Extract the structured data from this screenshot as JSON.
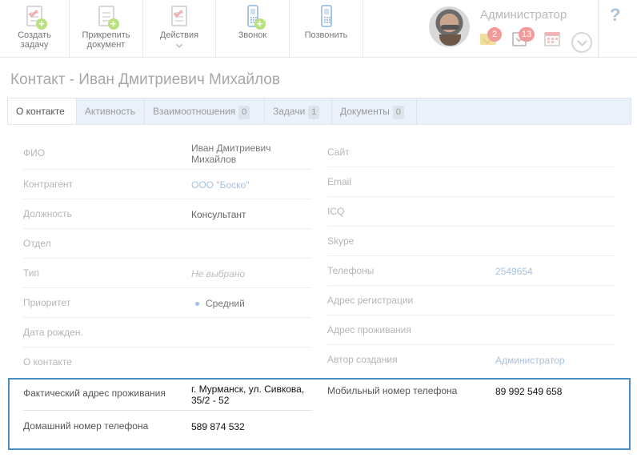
{
  "toolbar": {
    "create_task": "Создать\nзадачу",
    "attach_doc": "Прикрепить\nдокумент",
    "actions": "Действия",
    "call": "Звонок",
    "dial": "Позвонить"
  },
  "user": {
    "name": "Администратор",
    "mail_count": "2",
    "task_count": "13"
  },
  "help_label": "?",
  "page_title": "Контакт - Иван Дмитриевич Михайлов",
  "tabs": [
    {
      "label": "О контакте"
    },
    {
      "label": "Активность"
    },
    {
      "label": "Взаимоотношения",
      "count": "0"
    },
    {
      "label": "Задачи",
      "count": "1"
    },
    {
      "label": "Документы",
      "count": "0"
    }
  ],
  "left_fields": [
    {
      "label": "ФИО",
      "value": "Иван Дмитриевич\nМихайлов"
    },
    {
      "label": "Контрагент",
      "value": "ООО \"Боско\""
    },
    {
      "label": "Должность",
      "value": "Консультант"
    },
    {
      "label": "Отдел",
      "value": ""
    },
    {
      "label": "Тип",
      "value": "Не выбрано"
    },
    {
      "label": "Приоритет",
      "value": "Средний"
    },
    {
      "label": "Дата рожден.",
      "value": ""
    },
    {
      "label": "О контакте",
      "value": ""
    }
  ],
  "right_fields": [
    {
      "label": "Сайт",
      "value": ""
    },
    {
      "label": "Email",
      "value": ""
    },
    {
      "label": "ICQ",
      "value": ""
    },
    {
      "label": "Skype",
      "value": ""
    },
    {
      "label": "Телефоны",
      "value": "2549654"
    },
    {
      "label": "Адрес регистрации",
      "value": ""
    },
    {
      "label": "Адрес проживания",
      "value": ""
    },
    {
      "label": "Автор создания",
      "value": "Администратор"
    }
  ],
  "highlight": {
    "actual_address_label": "Фактический адрес проживания",
    "actual_address_value": "г. Мурманск, ул. Сивкова,\n35/2 - 52",
    "home_phone_label": "Домашний номер телефона",
    "home_phone_value": "589 874 532",
    "mobile_label": "Мобильный номер телефона",
    "mobile_value": "89 992 549 658"
  },
  "colors": {
    "highlight_border": "#4a8ec4",
    "link": "#a7c2df",
    "badge": "#f09a9a"
  }
}
